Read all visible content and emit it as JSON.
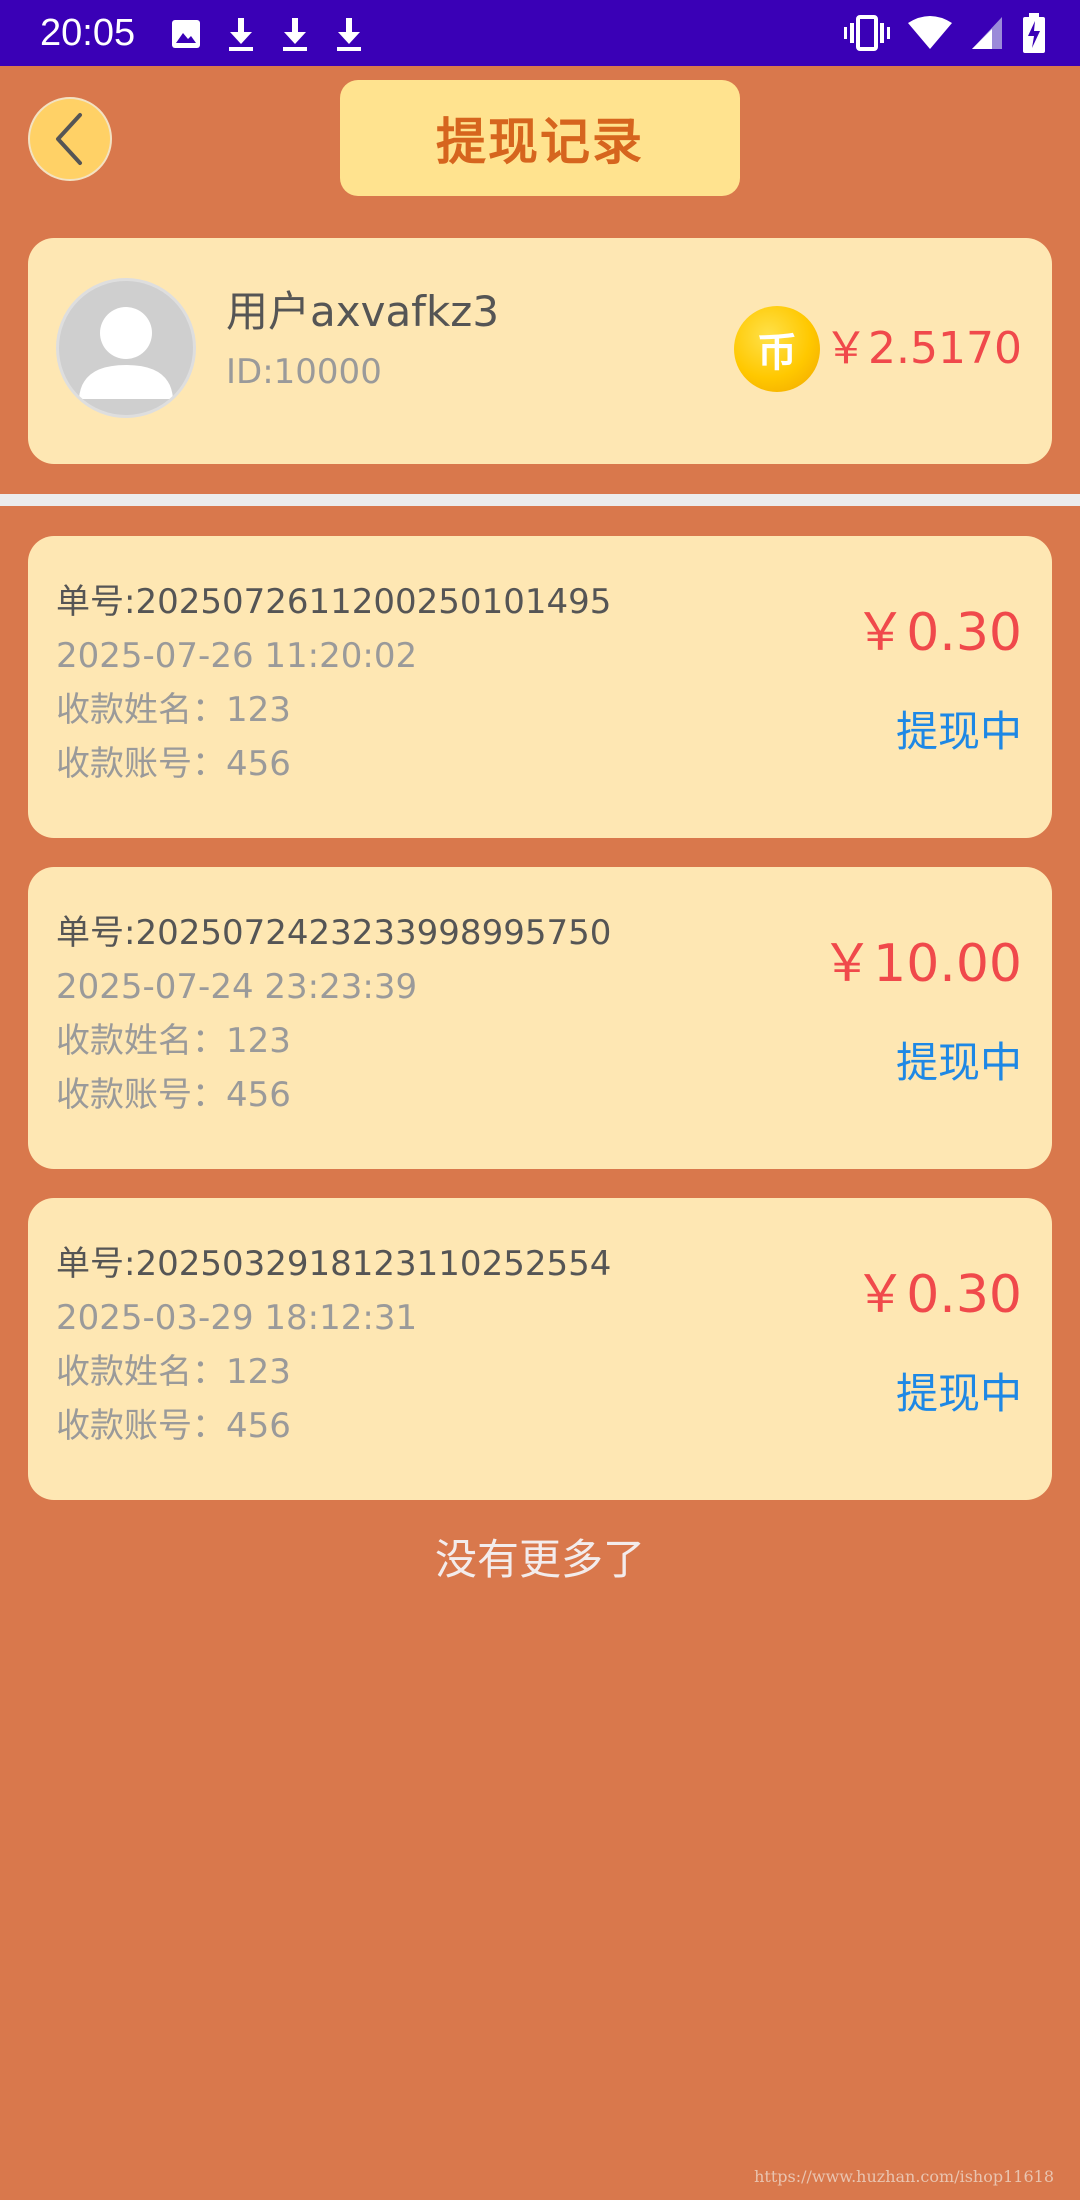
{
  "status_bar": {
    "time": "20:05",
    "left_icons": [
      "image-icon",
      "download-icon",
      "download-icon",
      "download-icon"
    ],
    "right_icons": [
      "vibrate-icon",
      "wifi-icon",
      "signal-icon",
      "battery-charging-icon"
    ]
  },
  "header": {
    "title": "提现记录",
    "back_icon": "chevron-left-icon"
  },
  "user": {
    "name": "用户axvafkz3",
    "id": "ID:10000",
    "coin_char": "币",
    "balance": "￥2.5170"
  },
  "records": [
    {
      "order": "单号:20250726112002501014​95",
      "time": "2025-07-26 11:20:02",
      "name": "收款姓名：123",
      "account": "收款账号：456",
      "amount": "￥0.30",
      "status": "提现中"
    },
    {
      "order": "单号:20250724232339989957​50",
      "time": "2025-07-24 23:23:39",
      "name": "收款姓名：123",
      "account": "收款账号：456",
      "amount": "￥10.00",
      "status": "提现中"
    },
    {
      "order": "单号:20250329181231102525​54",
      "time": "2025-03-29 18:12:31",
      "name": "收款姓名：123",
      "account": "收款账号：456",
      "amount": "￥0.30",
      "status": "提现中"
    }
  ],
  "footer": {
    "no_more": "没有更多了",
    "watermark": "https://www.huzhan.com/ishop11618"
  },
  "colors": {
    "background": "#d9784c",
    "status_bar": "#3a00b6",
    "card": "#fee7b3",
    "title_box": "#ffe38f",
    "title_text": "#d6651e",
    "amount": "#f0494b",
    "status": "#1e88e5"
  }
}
